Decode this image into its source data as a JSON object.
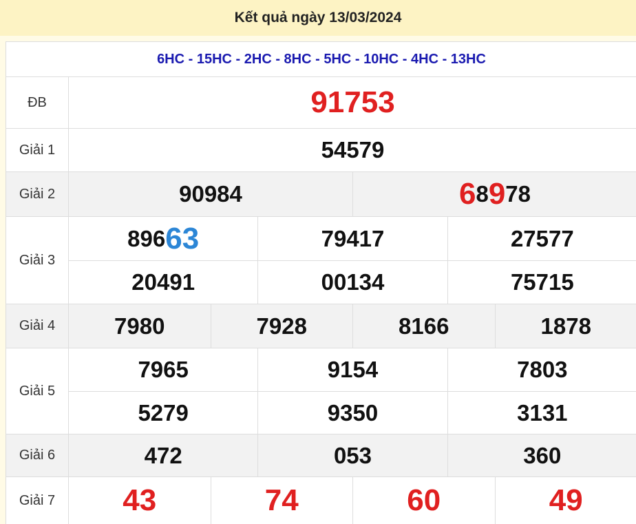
{
  "header": {
    "title": "Kết quả ngày 13/03/2024"
  },
  "codes": "6HC - 15HC - 2HC - 8HC - 5HC - 10HC - 4HC - 13HC",
  "prizes": {
    "db": {
      "label": "ĐB",
      "value": "91753"
    },
    "g1": {
      "label": "Giải 1",
      "value": "54579"
    },
    "g2": {
      "label": "Giải 2",
      "values": [
        "90984",
        "68978"
      ],
      "g2b_parts": [
        "6",
        "8",
        "9",
        "78"
      ]
    },
    "g3": {
      "label": "Giải 3",
      "values": [
        "89663",
        "79417",
        "27577",
        "20491",
        "00134",
        "75715"
      ],
      "g3a_parts": [
        "896",
        "63"
      ]
    },
    "g4": {
      "label": "Giải 4",
      "values": [
        "7980",
        "7928",
        "8166",
        "1878"
      ]
    },
    "g5": {
      "label": "Giải 5",
      "values": [
        "7965",
        "9154",
        "7803",
        "5279",
        "9350",
        "3131"
      ]
    },
    "g6": {
      "label": "Giải 6",
      "values": [
        "472",
        "053",
        "360"
      ]
    },
    "g7": {
      "label": "Giải 7",
      "values": [
        "43",
        "74",
        "60",
        "49"
      ]
    }
  },
  "colors": {
    "red": "#e02020",
    "blue": "#2c86d6",
    "codes": "#1a1ab0"
  }
}
